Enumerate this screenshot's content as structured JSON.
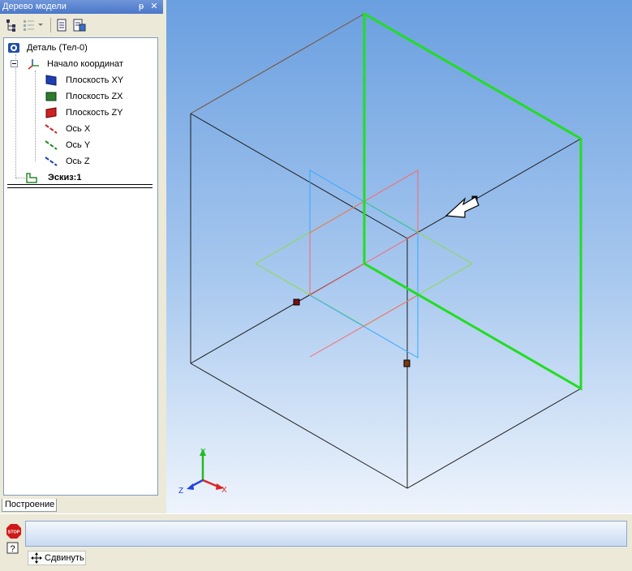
{
  "panel": {
    "title": "Дерево модели",
    "pin_glyph": "ᵽ",
    "close_glyph": "✕",
    "tab_label": "Построение"
  },
  "tree": {
    "root": "Деталь (Тел-0)",
    "origin": "Начало координат",
    "items": [
      {
        "label": "Плоскость XY",
        "icon": "plane-xy-icon"
      },
      {
        "label": "Плоскость ZX",
        "icon": "plane-zx-icon"
      },
      {
        "label": "Плоскость ZY",
        "icon": "plane-zy-icon"
      },
      {
        "label": "Ось X",
        "icon": "axis-x-icon"
      },
      {
        "label": "Ось Y",
        "icon": "axis-y-icon"
      },
      {
        "label": "Ось Z",
        "icon": "axis-z-icon"
      }
    ],
    "sketch": "Эскиз:1"
  },
  "viewport": {
    "axis_labels": {
      "x": "X",
      "y": "Y",
      "z": "Z"
    },
    "colors": {
      "highlight": "#22dd22",
      "edge": "#1a1a1a",
      "plane_xy": "#ff6666",
      "plane_zy": "#33aaff",
      "plane_zx": "#88dd44"
    }
  },
  "bottom": {
    "stop_label": "STOP",
    "help_label": "?",
    "move_label": "Сдвинуть"
  }
}
